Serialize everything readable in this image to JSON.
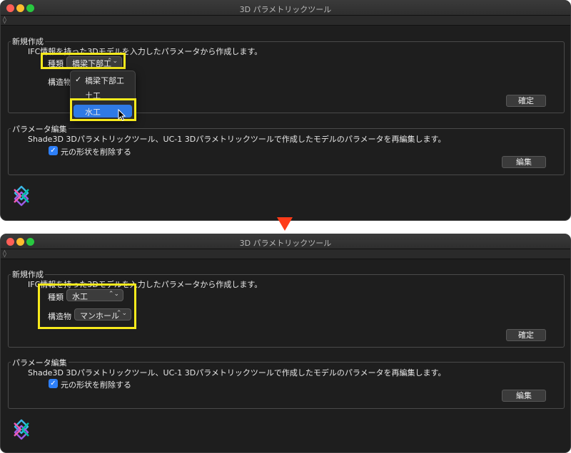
{
  "window_title": "3D パラメトリックツール",
  "new_section": {
    "title": "新規作成",
    "description": "IFC情報を持った3Dモデルを入力したパラメータから作成します。",
    "type_label": "種類",
    "structure_label": "構造物",
    "confirm_button": "確定"
  },
  "edit_section": {
    "title": "パラメータ編集",
    "description": "Shade3D 3Dパラメトリックツール、UC-1 3Dパラメトリックツールで作成したモデルのパラメータを再編集します。",
    "delete_original_label": "元の形状を削除する",
    "delete_original_checked": true,
    "edit_button": "編集"
  },
  "before": {
    "type_value": "橋梁下部工",
    "type_menu": [
      {
        "label": "橋梁下部工",
        "checked": true,
        "highlighted": false
      },
      {
        "label": "土工",
        "checked": false,
        "highlighted": false
      },
      {
        "label": "水工",
        "checked": false,
        "highlighted": true
      }
    ]
  },
  "after": {
    "type_value": "水工",
    "structure_value": "マンホール"
  },
  "icons": {
    "toolbar": "diamond-toggle-icon",
    "chevron": "up-down-chevron-icon",
    "checkmark": "checkmark-icon",
    "logo": "app-logo-icon",
    "arrow": "down-arrow-icon",
    "cursor": "mouse-pointer-icon"
  },
  "colors": {
    "highlight": "#f7ea1c",
    "arrow": "#ff3b19",
    "accent": "#2f7ae5"
  }
}
